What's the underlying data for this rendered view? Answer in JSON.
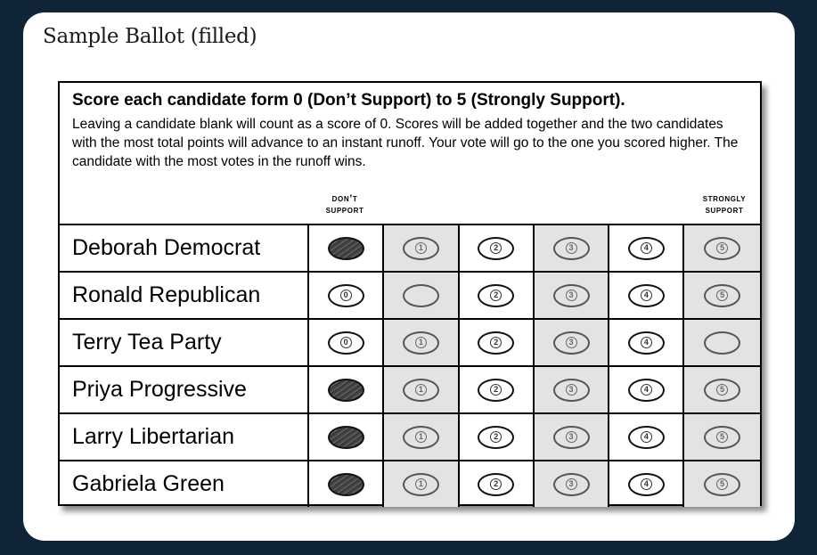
{
  "card_title": "Sample Ballot (filled)",
  "heading": "Score each candidate form 0 (Don’t Support) to 5 (Strongly Support).",
  "instructions": "Leaving a candidate blank will count as a score of 0. Scores will be added together and the two candidates with the most total points will advance to an instant runoff. Your vote will go to the one you scored higher. The candidate with the most votes in the runoff wins.",
  "labels": {
    "low_line1": "Don’t",
    "low_line2": "Support",
    "high_line1": "Strongly",
    "high_line2": "Support"
  },
  "score_options": [
    "0",
    "1",
    "2",
    "3",
    "4",
    "5"
  ],
  "candidates": [
    {
      "name": "Deborah Democrat",
      "score": 0
    },
    {
      "name": "Ronald Republican",
      "score": 1
    },
    {
      "name": "Terry Tea Party",
      "score": 5
    },
    {
      "name": "Priya Progressive",
      "score": 0
    },
    {
      "name": "Larry Libertarian",
      "score": 0
    },
    {
      "name": "Gabriela Green",
      "score": 0
    }
  ]
}
